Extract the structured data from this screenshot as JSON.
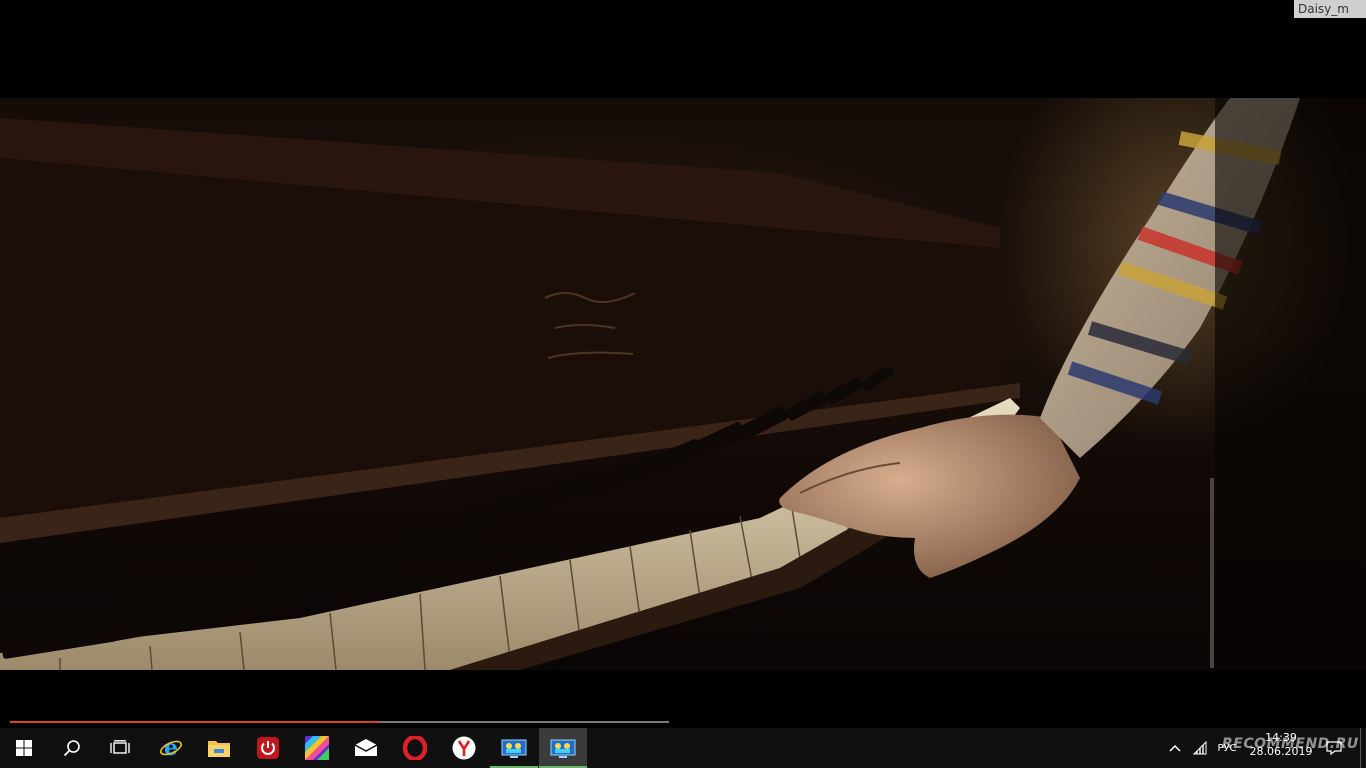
{
  "watermark": {
    "text": "Daisy_m"
  },
  "video": {
    "scene": "piano",
    "progress_percent": 56
  },
  "taskbar": {
    "apps": [
      {
        "name": "start-button",
        "icon": "windows-logo-icon"
      },
      {
        "name": "search-button",
        "icon": "search-icon"
      },
      {
        "name": "task-view-button",
        "icon": "task-view-icon"
      },
      {
        "name": "internet-explorer",
        "icon": "ie-icon"
      },
      {
        "name": "file-explorer",
        "icon": "folder-icon"
      },
      {
        "name": "power-app",
        "icon": "power-icon"
      },
      {
        "name": "paint-app",
        "icon": "colorful-app-icon"
      },
      {
        "name": "mail-app",
        "icon": "mail-icon"
      },
      {
        "name": "opera-browser",
        "icon": "opera-icon"
      },
      {
        "name": "yandex-browser",
        "icon": "yandex-icon"
      },
      {
        "name": "video-player-1",
        "icon": "media-player-icon"
      },
      {
        "name": "video-player-2",
        "icon": "media-player-icon"
      }
    ],
    "tray": {
      "language": "РУС",
      "time": "14:39",
      "date": "28.06.2019",
      "watermark": "RECOMMEND.RU"
    },
    "colors": {
      "accent_green": "#68b46a",
      "progress_red": "#e0421b",
      "opera_red": "#e01e25",
      "ie_blue": "#1ea7ff"
    }
  }
}
